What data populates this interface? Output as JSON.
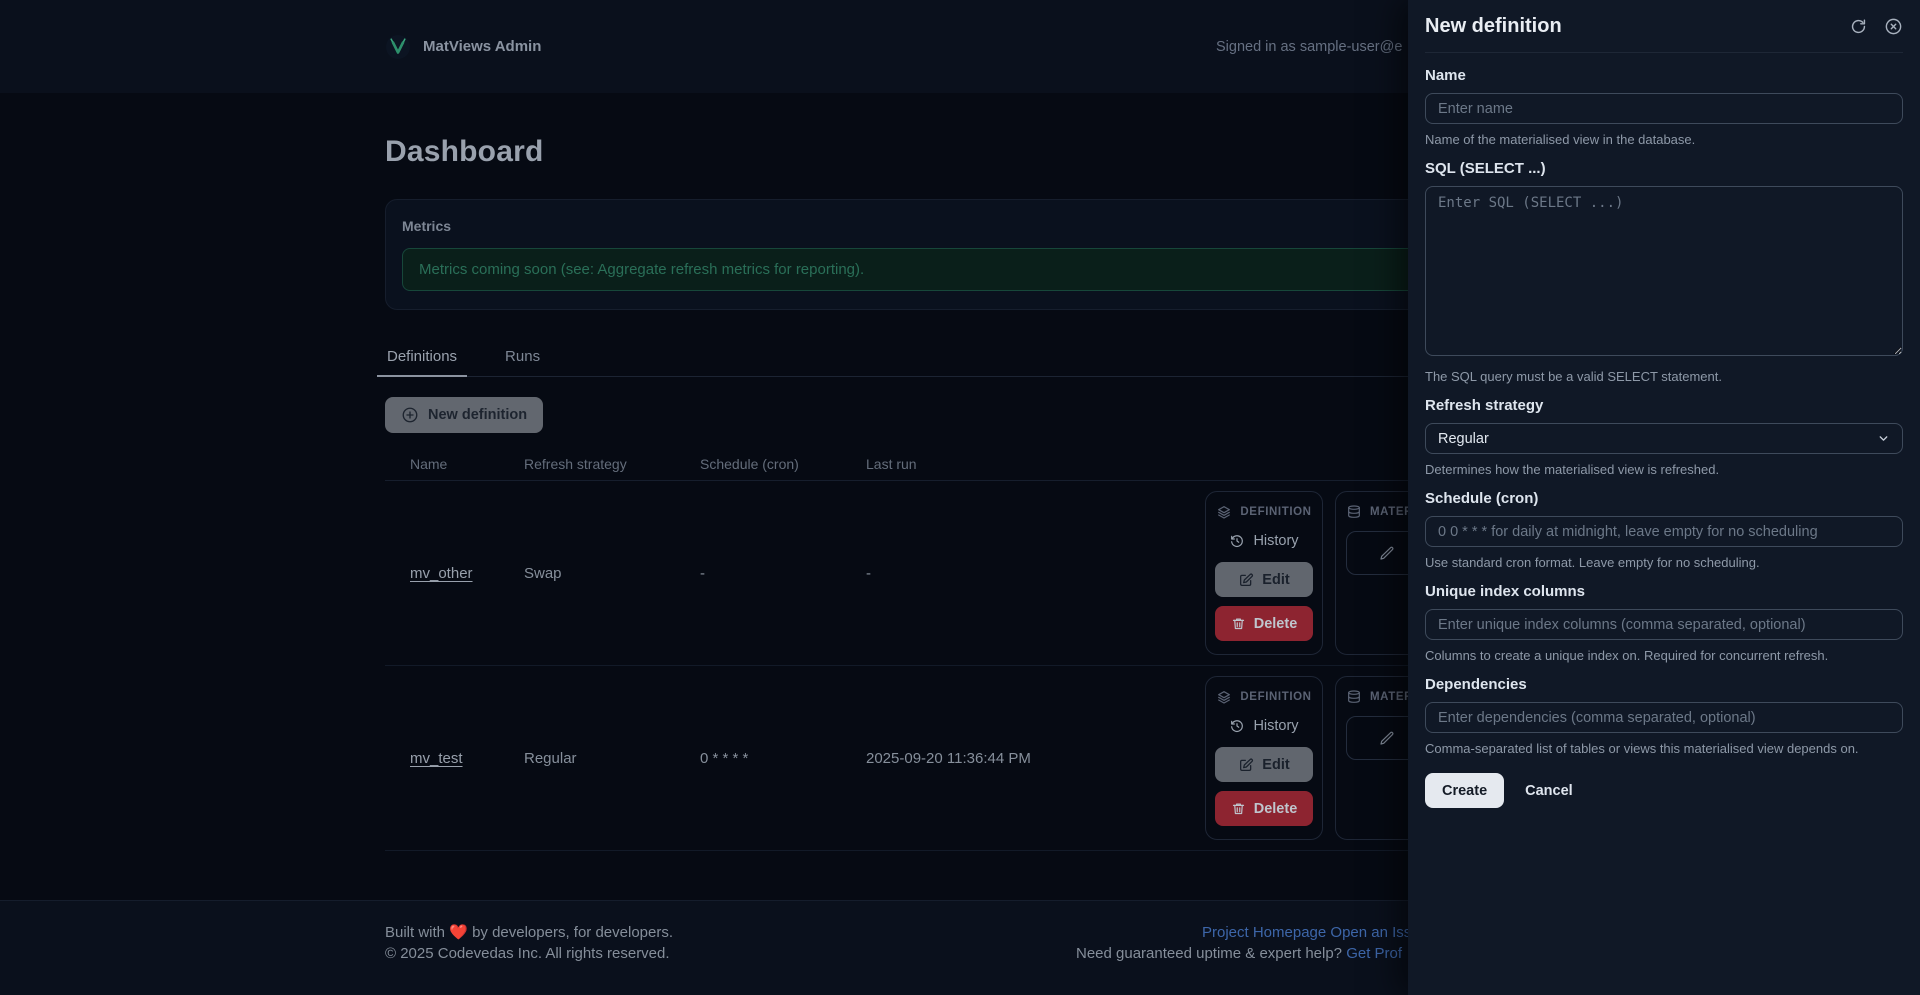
{
  "header": {
    "brand": "MatViews Admin",
    "signed_in": "Signed in as sample-user@e"
  },
  "page": {
    "title": "Dashboard"
  },
  "metrics": {
    "title": "Metrics",
    "notice": "Metrics coming soon (see: Aggregate refresh metrics for reporting)."
  },
  "tabs": [
    {
      "label": "Definitions"
    },
    {
      "label": "Runs"
    }
  ],
  "actions": {
    "new_definition": "New definition"
  },
  "table": {
    "columns": [
      "Name",
      "Refresh strategy",
      "Schedule (cron)",
      "Last run"
    ],
    "rows": [
      {
        "name": "mv_other",
        "refresh_strategy": "Swap",
        "schedule": "-",
        "last_run": "-"
      },
      {
        "name": "mv_test",
        "refresh_strategy": "Regular",
        "schedule": "0 * * * *",
        "last_run": "2025-09-20 11:36:44 PM"
      }
    ],
    "row_actions": {
      "definition_label": "DEFINITION",
      "materialised_label": "MATER",
      "history": "History",
      "edit": "Edit",
      "delete": "Delete"
    }
  },
  "footer": {
    "made_prefix": "Built with",
    "heart": "❤️",
    "made_suffix": "by developers, for developers.",
    "copyright": "© 2025 Codevedas Inc. All rights reserved.",
    "link_homepage": "Project Homepage",
    "link_issue": "Open an Iss",
    "support_text": "Need guaranteed uptime & expert help? ",
    "link_support": "Get Prof"
  },
  "drawer": {
    "title": "New definition",
    "fields": {
      "name": {
        "label": "Name",
        "placeholder": "Enter name",
        "helper": "Name of the materialised view in the database."
      },
      "sql": {
        "label": "SQL (SELECT ...)",
        "placeholder": "Enter SQL (SELECT ...)",
        "helper": "The SQL query must be a valid SELECT statement."
      },
      "refresh_strategy": {
        "label": "Refresh strategy",
        "value": "Regular",
        "helper": "Determines how the materialised view is refreshed."
      },
      "schedule": {
        "label": "Schedule (cron)",
        "placeholder": "0 0 * * * for daily at midnight, leave empty for no scheduling",
        "helper": "Use standard cron format. Leave empty for no scheduling."
      },
      "unique_index": {
        "label": "Unique index columns",
        "placeholder": "Enter unique index columns (comma separated, optional)",
        "helper": "Columns to create a unique index on. Required for concurrent refresh."
      },
      "dependencies": {
        "label": "Dependencies",
        "placeholder": "Enter dependencies (comma separated, optional)",
        "helper": "Comma-separated list of tables or views this materialised view depends on."
      }
    },
    "buttons": {
      "create": "Create",
      "cancel": "Cancel"
    }
  }
}
